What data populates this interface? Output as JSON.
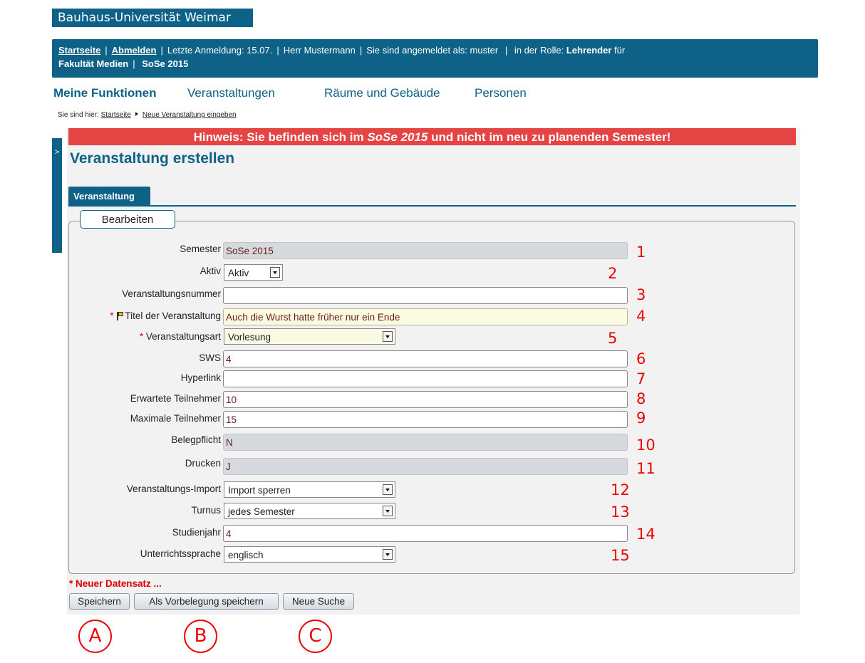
{
  "header": {
    "logo_text": "Bauhaus-Universität Weimar",
    "startseite": "Startseite",
    "abmelden": "Abmelden",
    "last_login": "Letzte Anmeldung:  15.07.",
    "user": "Herr Mustermann",
    "logged_in_as": "Sie sind angemeldet als: muster",
    "role_prefix": "in der Rolle:",
    "role": "Lehrender",
    "role_suffix": "für",
    "faculty": "Fakultät Medien",
    "semester": "SoSe 2015"
  },
  "nav": {
    "items": [
      "Meine Funktionen",
      "Veranstaltungen",
      "Räume und Gebäude",
      "Personen"
    ]
  },
  "breadcrumb": {
    "prefix": "Sie sind hier:",
    "items": [
      "Startseite",
      "Neue Veranstaltung eingeben"
    ]
  },
  "sidetab": {
    "label": ">"
  },
  "hint": {
    "part1": "Hinweis: Sie befinden sich im ",
    "semester": "SoSe 2015",
    "part2": " und nicht im neu zu planenden Semester!"
  },
  "page_title": "Veranstaltung erstellen",
  "tab": {
    "label": "Veranstaltung"
  },
  "legend": "Bearbeiten",
  "fields": {
    "semester": {
      "label": "Semester",
      "value": "SoSe 2015",
      "marker": "1"
    },
    "aktiv": {
      "label": "Aktiv",
      "value": "Aktiv",
      "marker": "2"
    },
    "nummer": {
      "label": "Veranstaltungsnummer",
      "value": "",
      "marker": "3"
    },
    "titel": {
      "required": "*",
      "label": "Titel der Veranstaltung",
      "value": "Auch die Wurst hatte früher nur ein Ende",
      "marker": "4"
    },
    "art": {
      "required": "*",
      "label": "Veranstaltungsart",
      "value": "Vorlesung",
      "marker": "5"
    },
    "sws": {
      "label": "SWS",
      "value": "4",
      "marker": "6"
    },
    "hyperlink": {
      "label": "Hyperlink",
      "value": "",
      "marker": "7"
    },
    "erwartete": {
      "label": "Erwartete Teilnehmer",
      "value": "10",
      "marker": "8"
    },
    "maximale": {
      "label": "Maximale Teilnehmer",
      "value": "15",
      "marker": "9"
    },
    "belegpflicht": {
      "label": "Belegpflicht",
      "value": "N",
      "marker": "10"
    },
    "drucken": {
      "label": "Drucken",
      "value": "J",
      "marker": "11"
    },
    "import": {
      "label": "Veranstaltungs-Import",
      "value": "Import sperren",
      "marker": "12"
    },
    "turnus": {
      "label": "Turnus",
      "value": "jedes Semester",
      "marker": "13"
    },
    "studienjahr": {
      "label": "Studienjahr",
      "value": "4",
      "marker": "14"
    },
    "sprache": {
      "label": "Unterrichtssprache",
      "value": "englisch",
      "marker": "15"
    }
  },
  "new_record": "* Neuer Datensatz ...",
  "buttons": {
    "save": "Speichern",
    "save_default": "Als Vorbelegung speichern",
    "new_search": "Neue Suche"
  },
  "annotations": [
    "A",
    "B",
    "C"
  ],
  "colors": {
    "brand": "#0e6288",
    "alert": "#e64444",
    "marker": "#e00000"
  }
}
